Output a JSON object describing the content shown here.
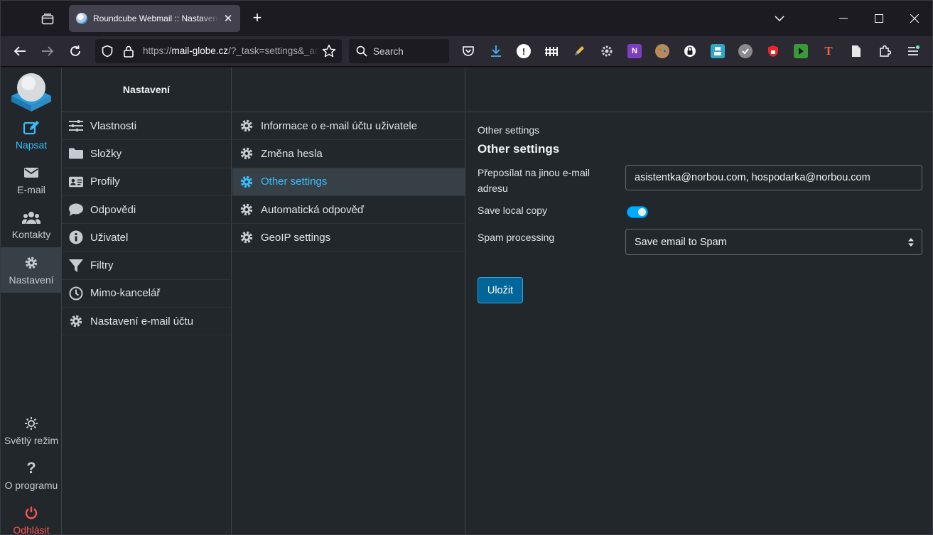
{
  "browser": {
    "tab_title": "Roundcube Webmail :: Nastavení - Other settings",
    "url_prefix": "https://",
    "url_host": "mail-globe.cz",
    "url_path": "/?_task=settings&_action=plugin.other",
    "search_placeholder": "Search"
  },
  "app": {
    "taskmenu": {
      "compose": "Napsat",
      "mail": "E-mail",
      "contacts": "Kontakty",
      "settings": "Nastavení",
      "light_mode": "Světlý režim",
      "about": "O programu",
      "logout": "Odhlásit"
    },
    "settings_column": {
      "title": "Nastavení",
      "items": [
        {
          "label": "Vlastnosti",
          "icon": "sliders-icon"
        },
        {
          "label": "Složky",
          "icon": "folder-icon"
        },
        {
          "label": "Profily",
          "icon": "id-card-icon"
        },
        {
          "label": "Odpovědi",
          "icon": "comment-icon"
        },
        {
          "label": "Uživatel",
          "icon": "info-icon"
        },
        {
          "label": "Filtry",
          "icon": "filter-icon"
        },
        {
          "label": "Mimo-kancelář",
          "icon": "clock-icon"
        },
        {
          "label": "Nastavení e-mail účtu",
          "icon": "gear-icon"
        }
      ]
    },
    "sections_column": {
      "items": [
        {
          "label": "Informace o e-mail účtu uživatele",
          "selected": false
        },
        {
          "label": "Změna hesla",
          "selected": false
        },
        {
          "label": "Other settings",
          "selected": true
        },
        {
          "label": "Automatická odpověď",
          "selected": false
        },
        {
          "label": "GeoIP settings",
          "selected": false
        }
      ]
    },
    "form": {
      "breadcrumb": "Other settings",
      "heading": "Other settings",
      "forward_label": "Přeposílat na jinou e-mail adresu",
      "forward_value": "asistentka@norbou.com, hospodarka@norbou.com",
      "save_local_copy_label": "Save local copy",
      "save_local_copy_on": true,
      "spam_label": "Spam processing",
      "spam_value": "Save email to Spam",
      "save_button": "Uložit"
    }
  },
  "colors": {
    "accent": "#37beff",
    "logout": "#ff5552",
    "background": "#21272b",
    "button": "#00669a"
  }
}
